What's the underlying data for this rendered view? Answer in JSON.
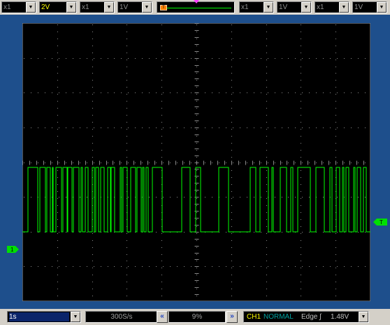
{
  "toolbar": {
    "ch1_probe": "x1",
    "ch1_volts": "2V",
    "ch2_probe": "x1",
    "ch2_volts": "1V",
    "ch3_probe": "x1",
    "ch3_volts": "1V",
    "ch4_probe": "x1",
    "ch4_volts": "1V",
    "trigger_thumb": "T",
    "colors": {
      "ch1": "#ffff00",
      "inactive": "#8a8a8a",
      "trace": "#00ff00",
      "trigger": "#ff8000"
    }
  },
  "screen": {
    "pretrigger_label": "T",
    "ch1_marker_label": "1",
    "trig_level_label": "T",
    "trace": {
      "description_hidden": false,
      "pulse_edges": [
        8,
        22,
        25,
        33,
        35,
        40,
        43,
        44,
        48,
        56,
        58,
        64,
        65,
        71,
        73,
        81,
        84,
        86,
        90,
        94,
        100,
        103,
        105,
        109,
        112,
        117,
        122,
        126,
        127,
        132,
        140,
        142,
        144,
        150,
        155,
        162,
        164,
        170,
        172,
        174,
        177,
        180,
        186,
        200,
        228,
        240,
        248,
        255,
        281,
        295,
        326,
        334,
        340,
        352,
        357,
        359,
        369,
        378,
        384,
        387,
        394,
        412,
        420,
        432,
        440,
        443,
        449,
        454,
        458,
        460,
        463,
        467,
        474,
        476,
        479,
        484,
        488,
        492
      ]
    }
  },
  "bottombar": {
    "timebase": "1s",
    "sample_rate": "300S/s",
    "position": "9%",
    "left_arrow": "«",
    "right_arrow": "»",
    "trigger_channel": "CH1",
    "trigger_mode": "NORMAL",
    "trigger_type": "Edge",
    "trigger_slope": "∫",
    "trigger_level": "1.48V"
  }
}
